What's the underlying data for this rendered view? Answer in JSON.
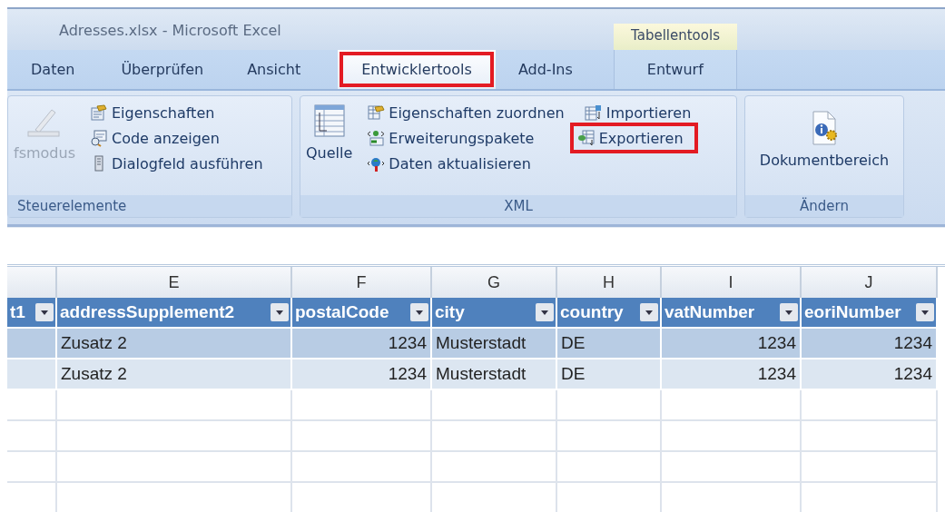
{
  "window": {
    "title": "Adresses.xlsx - Microsoft Excel",
    "context_group": "Tabellentools"
  },
  "tabs": [
    {
      "label": "Daten",
      "selected": false,
      "highlighted": false,
      "kind": "normal"
    },
    {
      "label": "Überprüfen",
      "selected": false,
      "highlighted": false,
      "kind": "normal"
    },
    {
      "label": "Ansicht",
      "selected": false,
      "highlighted": false,
      "kind": "normal"
    },
    {
      "label": "Entwicklertools",
      "selected": true,
      "highlighted": true,
      "kind": "normal"
    },
    {
      "label": "Add-Ins",
      "selected": false,
      "highlighted": false,
      "kind": "normal"
    },
    {
      "label": "Entwurf",
      "selected": false,
      "highlighted": false,
      "kind": "contextual"
    }
  ],
  "ribbon": {
    "groups": [
      {
        "title": "Steuerelemente",
        "large": {
          "label": "fsmodus",
          "disabled": true
        },
        "small": [
          {
            "label": "Eigenschaften",
            "highlighted": false
          },
          {
            "label": "Code anzeigen",
            "highlighted": false
          },
          {
            "label": "Dialogfeld ausführen",
            "highlighted": false
          }
        ]
      },
      {
        "title": "XML",
        "large": {
          "label": "Quelle",
          "disabled": false
        },
        "small": [
          {
            "label": "Eigenschaften zuordnen",
            "highlighted": false
          },
          {
            "label": "Erweiterungspakete",
            "highlighted": false
          },
          {
            "label": "Daten aktualisieren",
            "highlighted": false
          },
          {
            "label": "Importieren",
            "highlighted": false
          },
          {
            "label": "Exportieren",
            "highlighted": true
          }
        ]
      },
      {
        "title": "Ändern",
        "large": {
          "label": "Dokumentbereich",
          "disabled": false
        }
      }
    ]
  },
  "sheet": {
    "columns": [
      {
        "header": "t1"
      },
      {
        "letter": "E",
        "header": "addressSupplement2"
      },
      {
        "letter": "F",
        "header": "postalCode"
      },
      {
        "letter": "G",
        "header": "city"
      },
      {
        "letter": "H",
        "header": "country"
      },
      {
        "letter": "I",
        "header": "vatNumber"
      },
      {
        "letter": "J",
        "header": "eoriNumber"
      }
    ],
    "rows": [
      {
        "cells": [
          "",
          "Zusatz 2",
          "1234",
          "Musterstadt",
          "DE",
          "1234",
          "1234"
        ]
      },
      {
        "cells": [
          "",
          "Zusatz 2",
          "1234",
          "Musterstadt",
          "DE",
          "1234",
          "1234"
        ]
      }
    ]
  }
}
